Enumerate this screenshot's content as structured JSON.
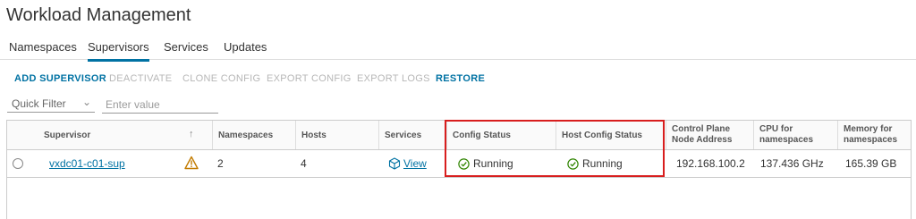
{
  "app": {
    "title": "Workload Management"
  },
  "tabs": [
    {
      "label": "Namespaces",
      "active": false
    },
    {
      "label": "Supervisors",
      "active": true
    },
    {
      "label": "Services",
      "active": false
    },
    {
      "label": "Updates",
      "active": false
    }
  ],
  "actions": {
    "add_supervisor": "ADD SUPERVISOR",
    "deactivate": "DEACTIVATE",
    "clone_config": "CLONE CONFIG",
    "export_config": "EXPORT CONFIG",
    "export_logs": "EXPORT LOGS",
    "restore": "RESTORE"
  },
  "filter": {
    "selected": "Quick Filter",
    "placeholder": "Enter value"
  },
  "table": {
    "headers": {
      "supervisor": "Supervisor",
      "namespaces": "Namespaces",
      "hosts": "Hosts",
      "services": "Services",
      "config_status": "Config Status",
      "host_config_status": "Host Config Status",
      "control_plane_line1": "Control Plane",
      "control_plane_line2": "Node Address",
      "cpu_line1": "CPU for",
      "cpu_line2": "namespaces",
      "memory_line1": "Memory for",
      "memory_line2": "namespaces"
    },
    "rows": [
      {
        "supervisor": "vxdc01-c01-sup",
        "namespaces": "2",
        "hosts": "4",
        "services": "View",
        "config_status": "Running",
        "host_config_status": "Running",
        "control_plane": "192.168.100.2",
        "cpu": "137.436 GHz",
        "memory": "165.39 GB"
      }
    ]
  },
  "colors": {
    "accent": "#0072a3",
    "running": "#2f8400",
    "warning": "#c27b00",
    "highlight": "#d81e1e"
  },
  "icons": {
    "sort": "arrow-up-icon",
    "warning": "warning-triangle-icon",
    "status": "check-circle-icon",
    "service": "cube-icon"
  }
}
